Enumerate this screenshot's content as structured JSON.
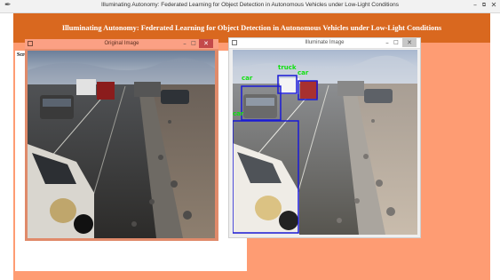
{
  "window": {
    "title": "Illuminating Autonomy: Federated Learning for Object Detection in Autonomous Vehicles under Low-Light Conditions",
    "icon": "feather-icon"
  },
  "header": {
    "title": "Illuminating Autonomy: Federated Learning for Object Detection in Autonomous Vehicles under Low-Light Conditions"
  },
  "output_panel": {
    "label": "Scre"
  },
  "original_window": {
    "title": "Original Image"
  },
  "illuminate_window": {
    "title": "Illuminate Image",
    "detections": [
      {
        "label": "car"
      },
      {
        "label": "truck"
      },
      {
        "label": "car"
      },
      {
        "label": "car"
      },
      {
        "label": ""
      }
    ]
  },
  "colors": {
    "app_background": "#fe9c73",
    "header": "#d9681f",
    "detection_box": "#1a1ad6",
    "detection_label": "#10e010"
  }
}
